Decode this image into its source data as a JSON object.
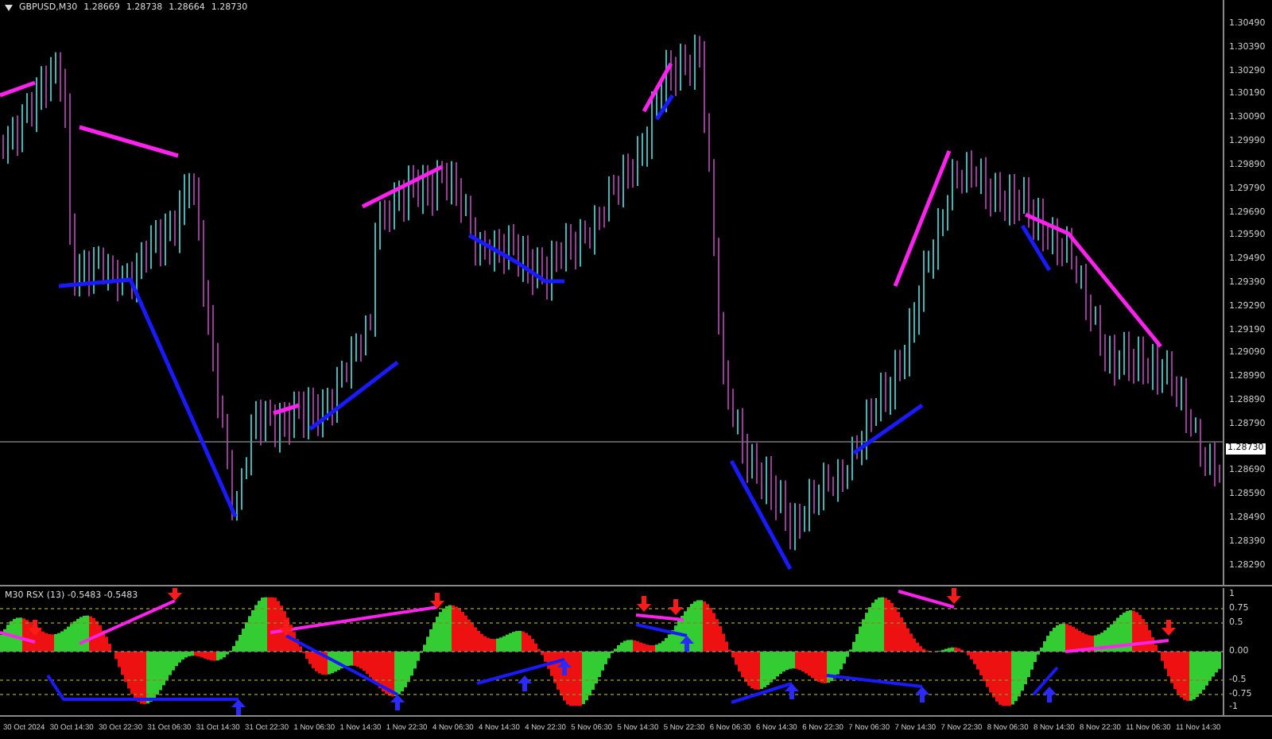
{
  "chart_header": {
    "symbol": "GBPUSD,M30",
    "open": "1.28669",
    "high": "1.28738",
    "low": "1.28664",
    "close": "1.28730"
  },
  "price_axis": {
    "labels": [
      "1.30490",
      "1.30390",
      "1.30290",
      "1.30190",
      "1.30090",
      "1.29990",
      "1.29890",
      "1.29790",
      "1.29690",
      "1.29590",
      "1.29490",
      "1.29390",
      "1.29290",
      "1.29190",
      "1.29090",
      "1.28990",
      "1.28890",
      "1.28790",
      "1.28690",
      "1.28590",
      "1.28490",
      "1.28390",
      "1.28290"
    ],
    "current_price": "1.28730"
  },
  "indicator": {
    "header": "M30  RSX (13) -0.5483 -0.5483",
    "axis_labels": [
      "1",
      "0.75",
      "0.5",
      "0.00",
      "-0.5",
      "-0.75",
      "-1"
    ]
  },
  "time_axis": [
    "30 Oct 2024",
    "30 Oct 14:30",
    "30 Oct 22:30",
    "31 Oct 06:30",
    "31 Oct 14:30",
    "31 Oct 22:30",
    "1 Nov 06:30",
    "1 Nov 14:30",
    "1 Nov 22:30",
    "4 Nov 06:30",
    "4 Nov 14:30",
    "4 Nov 22:30",
    "5 Nov 06:30",
    "5 Nov 14:30",
    "5 Nov 22:30",
    "6 Nov 06:30",
    "6 Nov 14:30",
    "6 Nov 22:30",
    "7 Nov 06:30",
    "7 Nov 14:30",
    "7 Nov 22:30",
    "8 Nov 06:30",
    "8 Nov 14:30",
    "8 Nov 22:30",
    "11 Nov 06:30",
    "11 Nov 14:30"
  ]
}
